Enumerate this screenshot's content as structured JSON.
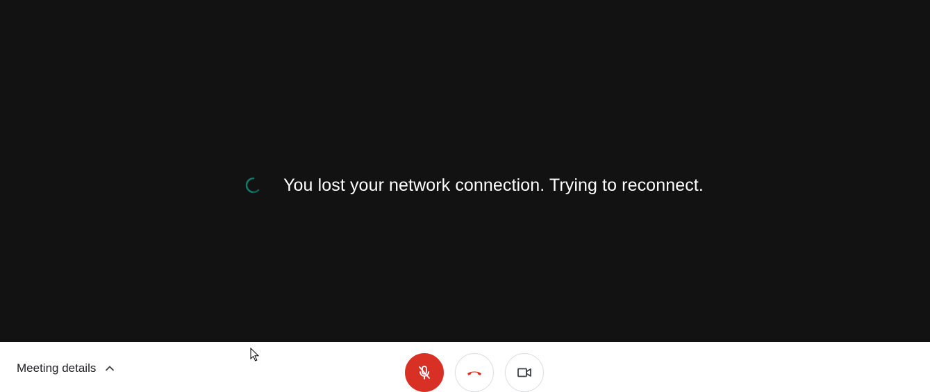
{
  "stage": {
    "background": "#121212",
    "status_message": "You lost your network connection. Trying to reconnect.",
    "spinner_icon": "loading-spinner-icon",
    "spinner_color": "#137a6b"
  },
  "bottom_bar": {
    "meeting_details_label": "Meeting details",
    "meeting_details_icon": "chevron-up-icon",
    "controls": [
      {
        "name": "mic-button",
        "icon": "mic-off-icon",
        "state": "muted",
        "color": "#d93025"
      },
      {
        "name": "hangup-button",
        "icon": "phone-hangup-icon",
        "color": "#d93025"
      },
      {
        "name": "camera-button",
        "icon": "videocam-icon"
      }
    ]
  }
}
